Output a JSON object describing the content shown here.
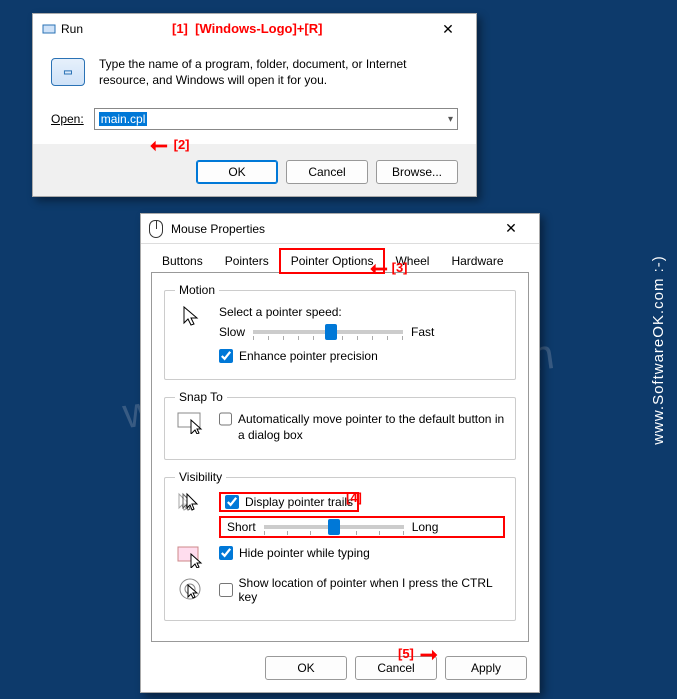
{
  "annotations": {
    "a1_num": "[1]",
    "a1_text": "[Windows-Logo]+[R]",
    "a2": "[2]",
    "a3": "[3]",
    "a4": "[4]",
    "a5": "[5]"
  },
  "run": {
    "title": "Run",
    "description": "Type the name of a program, folder, document, or Internet resource, and Windows will open it for you.",
    "open_label": "Open:",
    "open_value": "main.cpl",
    "ok": "OK",
    "cancel": "Cancel",
    "browse": "Browse..."
  },
  "mouse": {
    "title": "Mouse Properties",
    "tabs": {
      "buttons": "Buttons",
      "pointers": "Pointers",
      "pointer_options": "Pointer Options",
      "wheel": "Wheel",
      "hardware": "Hardware"
    },
    "motion": {
      "legend": "Motion",
      "select_speed": "Select a pointer speed:",
      "slow": "Slow",
      "fast": "Fast",
      "enhance": "Enhance pointer precision"
    },
    "snap": {
      "legend": "Snap To",
      "auto_move": "Automatically move pointer to the default button in a dialog box"
    },
    "visibility": {
      "legend": "Visibility",
      "trails": "Display pointer trails",
      "short": "Short",
      "long": "Long",
      "hide_typing": "Hide pointer while typing",
      "show_ctrl": "Show location of pointer when I press the CTRL key"
    },
    "ok": "OK",
    "cancel": "Cancel",
    "apply": "Apply"
  },
  "watermark": "www.SoftwareOK.com",
  "sidetext": "www.SoftwareOK.com :-)"
}
